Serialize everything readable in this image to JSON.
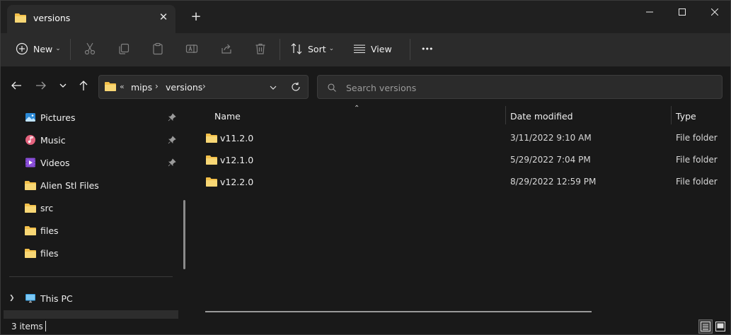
{
  "window": {
    "tab_title": "versions",
    "new_tab_symbol": "+",
    "tab_close_symbol": "✕"
  },
  "toolbar": {
    "new_label": "New",
    "sort_label": "Sort",
    "view_label": "View",
    "more_symbol": "•••",
    "icons": [
      "cut-icon",
      "copy-icon",
      "paste-icon",
      "rename-icon",
      "share-icon",
      "delete-icon"
    ]
  },
  "address": {
    "overflow": "«",
    "crumbs": [
      "mips",
      "versions"
    ],
    "search_placeholder": "Search versions"
  },
  "nav": {
    "items": [
      {
        "label": "Pictures",
        "icon": "pictures-icon",
        "pinned": true
      },
      {
        "label": "Music",
        "icon": "music-icon",
        "pinned": true
      },
      {
        "label": "Videos",
        "icon": "videos-icon",
        "pinned": true
      },
      {
        "label": "Alien Stl Files",
        "icon": "folder-icon",
        "pinned": false
      },
      {
        "label": "src",
        "icon": "folder-icon",
        "pinned": false
      },
      {
        "label": "files",
        "icon": "folder-icon",
        "pinned": false
      },
      {
        "label": "files",
        "icon": "folder-icon",
        "pinned": false
      }
    ],
    "this_pc_label": "This PC"
  },
  "columns": {
    "name": "Name",
    "date": "Date modified",
    "type": "Type"
  },
  "files": [
    {
      "name": "v11.2.0",
      "date": "3/11/2022 9:10 AM",
      "type": "File folder"
    },
    {
      "name": "v12.1.0",
      "date": "5/29/2022 7:04 PM",
      "type": "File folder"
    },
    {
      "name": "v12.2.0",
      "date": "8/29/2022 12:59 PM",
      "type": "File folder"
    }
  ],
  "status": {
    "item_count": "3 items"
  },
  "colors": {
    "folder": "#f3c04a",
    "accent": "#4cc2ff"
  }
}
